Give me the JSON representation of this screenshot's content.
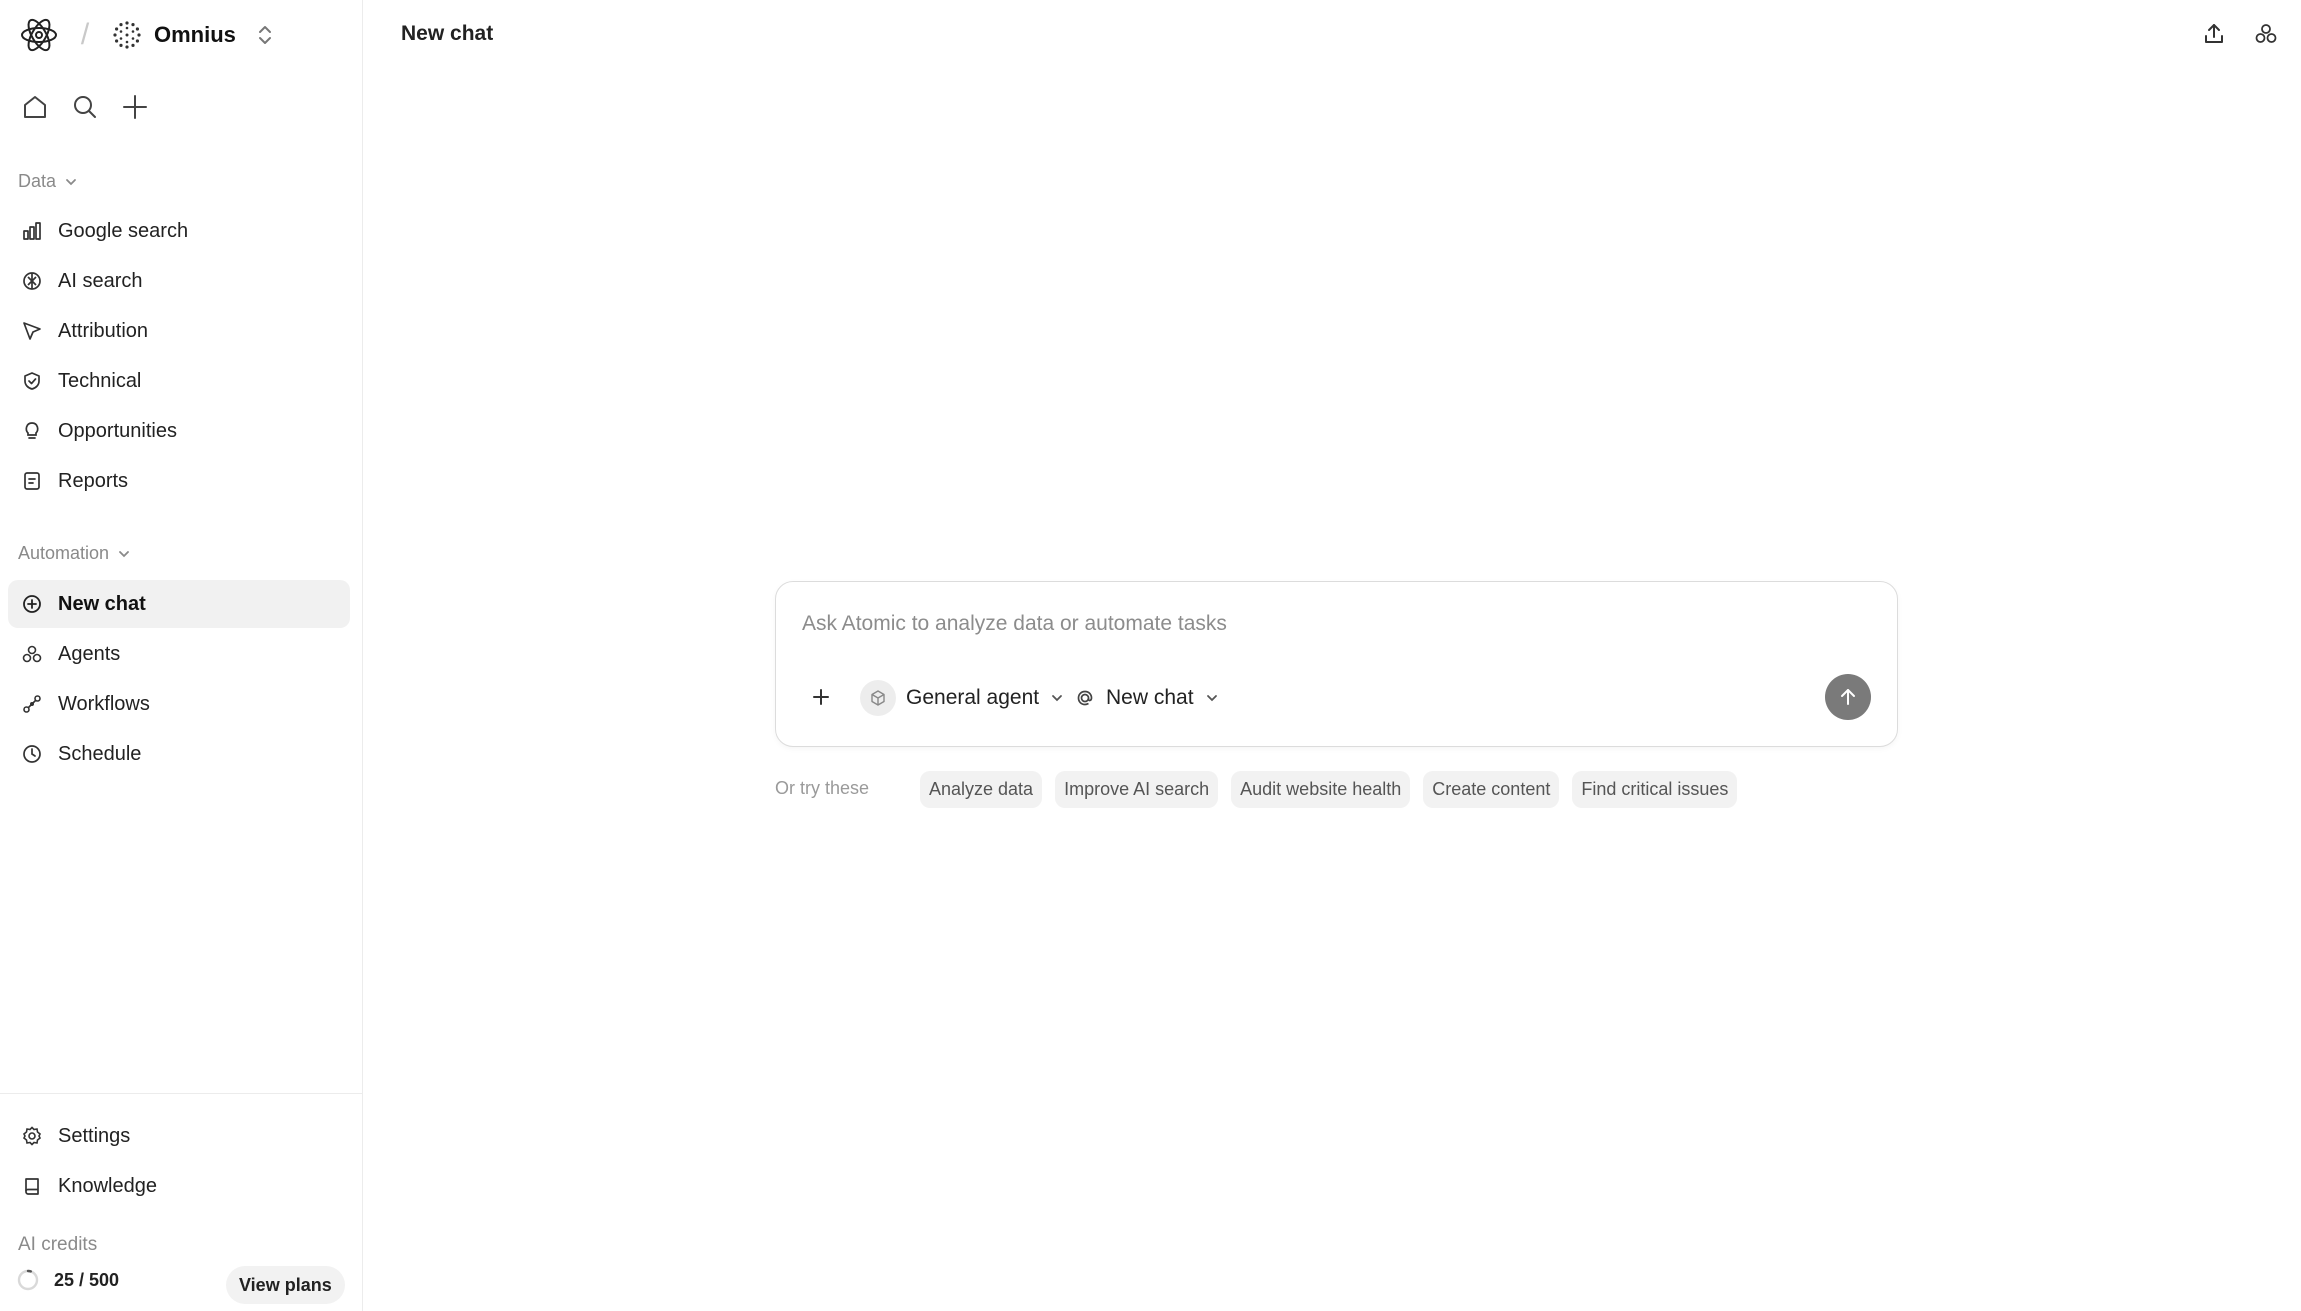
{
  "workspace": {
    "name": "Omnius"
  },
  "page": {
    "title": "New chat"
  },
  "sidebar": {
    "data_section": {
      "label": "Data",
      "items": [
        {
          "label": "Google search",
          "icon": "bar-chart-icon"
        },
        {
          "label": "AI search",
          "icon": "ai-globe-icon"
        },
        {
          "label": "Attribution",
          "icon": "cursor-pointer-icon"
        },
        {
          "label": "Technical",
          "icon": "shield-check-icon"
        },
        {
          "label": "Opportunities",
          "icon": "lightbulb-icon"
        },
        {
          "label": "Reports",
          "icon": "report-doc-icon"
        }
      ]
    },
    "automation_section": {
      "label": "Automation",
      "items": [
        {
          "label": "New chat",
          "icon": "plus-circle-icon",
          "active": true
        },
        {
          "label": "Agents",
          "icon": "agents-icon"
        },
        {
          "label": "Workflows",
          "icon": "workflow-icon"
        },
        {
          "label": "Schedule",
          "icon": "clock-icon"
        }
      ]
    },
    "bottom_items": [
      {
        "label": "Settings",
        "icon": "gear-icon"
      },
      {
        "label": "Knowledge",
        "icon": "book-icon"
      }
    ],
    "credits": {
      "label": "AI credits",
      "count": "25 / 500",
      "used": 25,
      "total": 500,
      "button": "View plans"
    }
  },
  "composer": {
    "placeholder": "Ask Atomic to analyze data or automate tasks",
    "agent": "General agent",
    "chat": "New chat"
  },
  "suggestions": {
    "label": "Or try these",
    "chips": [
      "Analyze data",
      "Improve AI search",
      "Audit website health",
      "Create content",
      "Find critical issues"
    ]
  },
  "colors": {
    "accent": "#7a7a7a",
    "active_bg": "#f1f1f1",
    "border": "#dcdcdc"
  }
}
